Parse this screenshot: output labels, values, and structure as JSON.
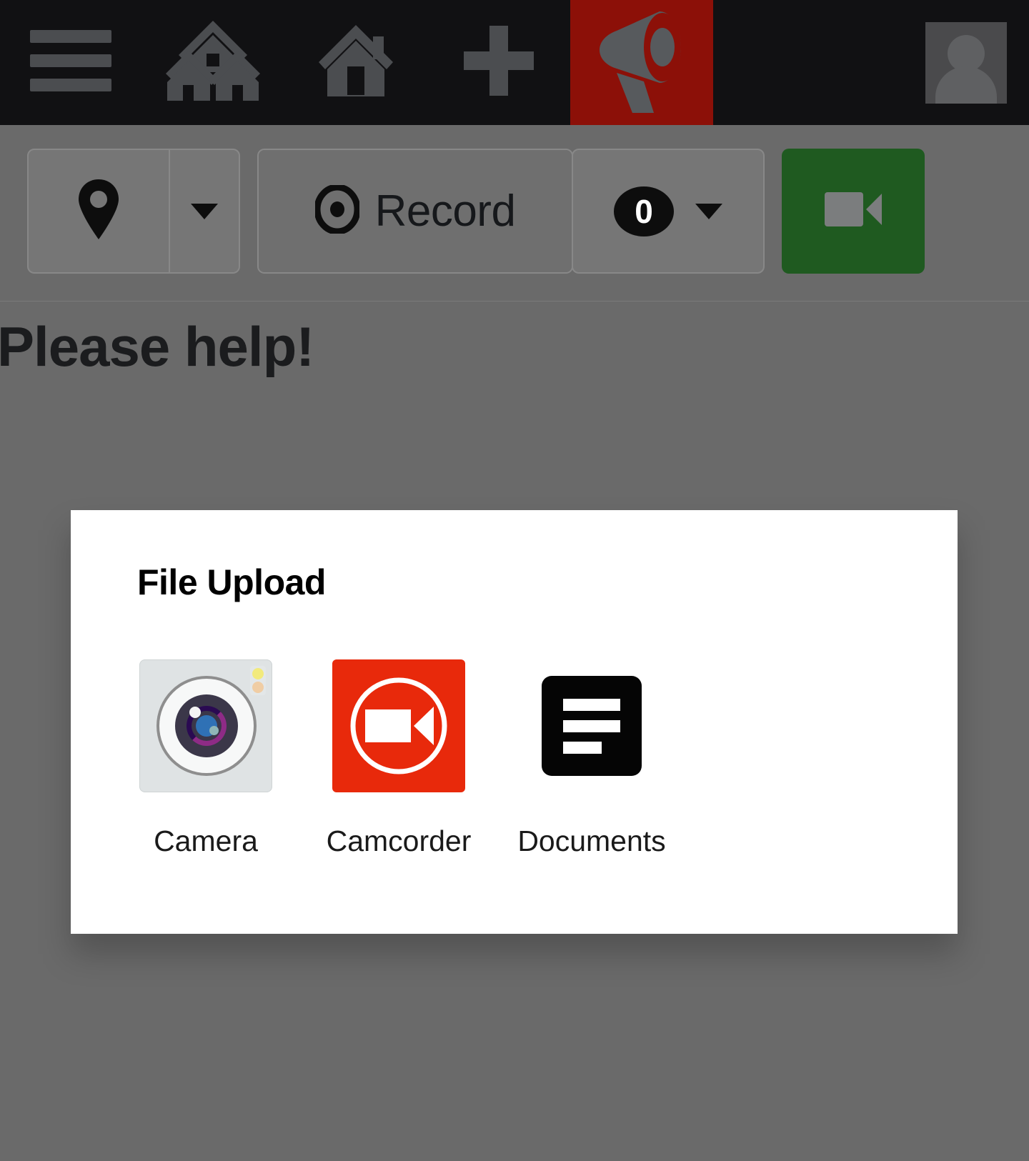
{
  "topbar": {
    "background_color": "#111113",
    "highlight_color": "#8c1008",
    "icon_color": "#4b4d50",
    "items": [
      {
        "name": "menu",
        "icon": "hamburger-menu-icon",
        "label": "Menu",
        "highlighted": false
      },
      {
        "name": "neighborhood",
        "icon": "neighborhood-houses-icon",
        "label": "Neighborhood",
        "highlighted": false
      },
      {
        "name": "home",
        "icon": "home-icon",
        "label": "Home",
        "highlighted": false
      },
      {
        "name": "add",
        "icon": "plus-icon",
        "label": "Add",
        "highlighted": false
      },
      {
        "name": "alerts",
        "icon": "megaphone-icon",
        "label": "Alerts",
        "highlighted": true
      }
    ],
    "avatar": {
      "name": "user-avatar",
      "label": "Account"
    }
  },
  "toolbar": {
    "background_color": "#6a6a6a",
    "location": {
      "icon": "map-pin-icon",
      "label": "Location",
      "caret": "caret-down-icon"
    },
    "record": {
      "icon": "record-dot-icon",
      "label": "Record"
    },
    "count": {
      "value": "0",
      "caret": "caret-down-icon",
      "label": "Count"
    },
    "video": {
      "icon": "video-camera-icon",
      "label": "Video",
      "color": "#1f5a20"
    }
  },
  "page": {
    "title": "Please help!"
  },
  "dialog": {
    "title": "File Upload",
    "background_color": "#ffffff",
    "options": [
      {
        "label": "Camera",
        "icon": "camera-app-icon"
      },
      {
        "label": "Camcorder",
        "icon": "camcorder-app-icon",
        "color": "#e8290b"
      },
      {
        "label": "Documents",
        "icon": "documents-app-icon",
        "color": "#050505"
      }
    ]
  }
}
